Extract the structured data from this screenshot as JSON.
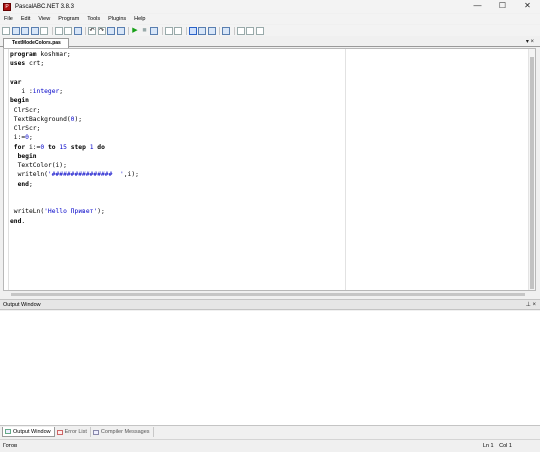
{
  "window": {
    "title": "PascalABC.NET 3.8.3",
    "icon": "app-logo-icon",
    "controls": [
      "minimize-icon",
      "maximize-icon",
      "close-icon"
    ]
  },
  "menu": [
    "File",
    "Edit",
    "View",
    "Program",
    "Tools",
    "Plugins",
    "Help"
  ],
  "editor": {
    "tab_label": "TextModeColors.pas",
    "tab_controls": "▾ ×",
    "lines": [
      [
        [
          "kw",
          "program"
        ],
        [
          "plain",
          " koshmar;"
        ]
      ],
      [
        [
          "kw",
          "uses"
        ],
        [
          "plain",
          " crt;"
        ]
      ],
      [],
      [
        [
          "kw",
          "var"
        ]
      ],
      [
        [
          "plain",
          "   i :"
        ],
        [
          "num",
          "integer"
        ],
        [
          "plain",
          ";"
        ]
      ],
      [
        [
          "kw",
          "begin"
        ]
      ],
      [
        [
          "plain",
          " ClrScr;"
        ]
      ],
      [
        [
          "plain",
          " TextBackground("
        ],
        [
          "num",
          "0"
        ],
        [
          "plain",
          ");"
        ]
      ],
      [
        [
          "plain",
          " ClrScr;"
        ]
      ],
      [
        [
          "plain",
          " i:="
        ],
        [
          "num",
          "0"
        ],
        [
          "plain",
          ";"
        ]
      ],
      [
        [
          "plain",
          " "
        ],
        [
          "kw",
          "for"
        ],
        [
          "plain",
          " i:="
        ],
        [
          "num",
          "0"
        ],
        [
          "plain",
          " "
        ],
        [
          "kw",
          "to"
        ],
        [
          "plain",
          " "
        ],
        [
          "num",
          "15"
        ],
        [
          "plain",
          " "
        ],
        [
          "kw",
          "step"
        ],
        [
          "plain",
          " "
        ],
        [
          "num",
          "1"
        ],
        [
          "plain",
          " "
        ],
        [
          "kw",
          "do"
        ]
      ],
      [
        [
          "plain",
          "  "
        ],
        [
          "kw",
          "begin"
        ]
      ],
      [
        [
          "plain",
          "  TextColor(i);"
        ]
      ],
      [
        [
          "plain",
          "  writeln("
        ],
        [
          "str",
          "'################  '"
        ],
        [
          "plain",
          ",i);"
        ]
      ],
      [
        [
          "plain",
          "  "
        ],
        [
          "kw",
          "end"
        ],
        [
          "plain",
          ";"
        ]
      ],
      [],
      [],
      [
        [
          "plain",
          " writeLn("
        ],
        [
          "str",
          "'Hello Привет'"
        ],
        [
          "plain",
          ");"
        ]
      ],
      [
        [
          "kw",
          "end"
        ],
        [
          "plain",
          "."
        ]
      ]
    ]
  },
  "output": {
    "title": "Output Window",
    "controls": "⊥ ×"
  },
  "bottom_tabs": [
    {
      "label": "Output Window",
      "active": true
    },
    {
      "label": "Error List",
      "active": false
    },
    {
      "label": "Compiler Messages",
      "active": false
    }
  ],
  "status": {
    "mode": "Готов",
    "ln": "Ln 1",
    "col": "Col 1"
  }
}
